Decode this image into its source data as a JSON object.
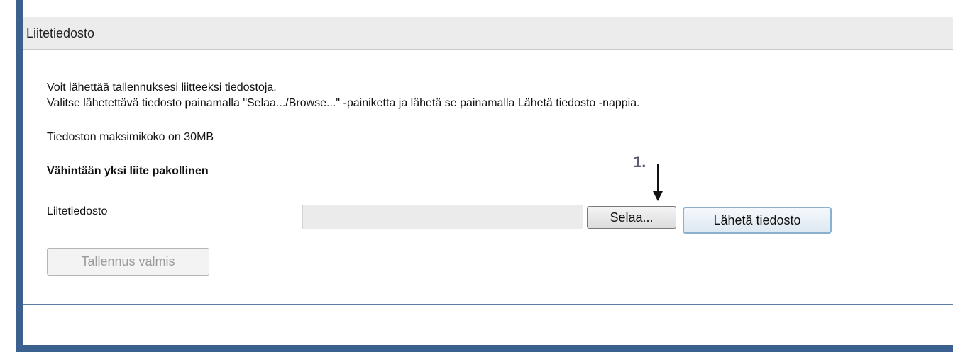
{
  "section": {
    "title": "Liitetiedosto"
  },
  "instructions": {
    "line1": "Voit lähettää tallennuksesi liitteeksi tiedostoja.",
    "line2": "Valitse lähetettävä tiedosto painamalla \"Selaa.../Browse...\" -painiketta ja lähetä se painamalla Lähetä tiedosto -nappia."
  },
  "max_size_text": "Tiedoston maksimikoko on 30MB",
  "required_text": "Vähintään yksi liite pakollinen",
  "upload": {
    "label": "Liitetiedosto",
    "file_value": "",
    "browse_label": "Selaa...",
    "send_label": "Lähetä tiedosto"
  },
  "save_button": {
    "label": "Tallennus valmis",
    "disabled": true
  },
  "annotation": {
    "number": "1."
  },
  "colors": {
    "frame_border": "#3a6190",
    "header_bg": "#ececec",
    "divider": "#5b7fa5",
    "annotation": "#5c5c70"
  }
}
